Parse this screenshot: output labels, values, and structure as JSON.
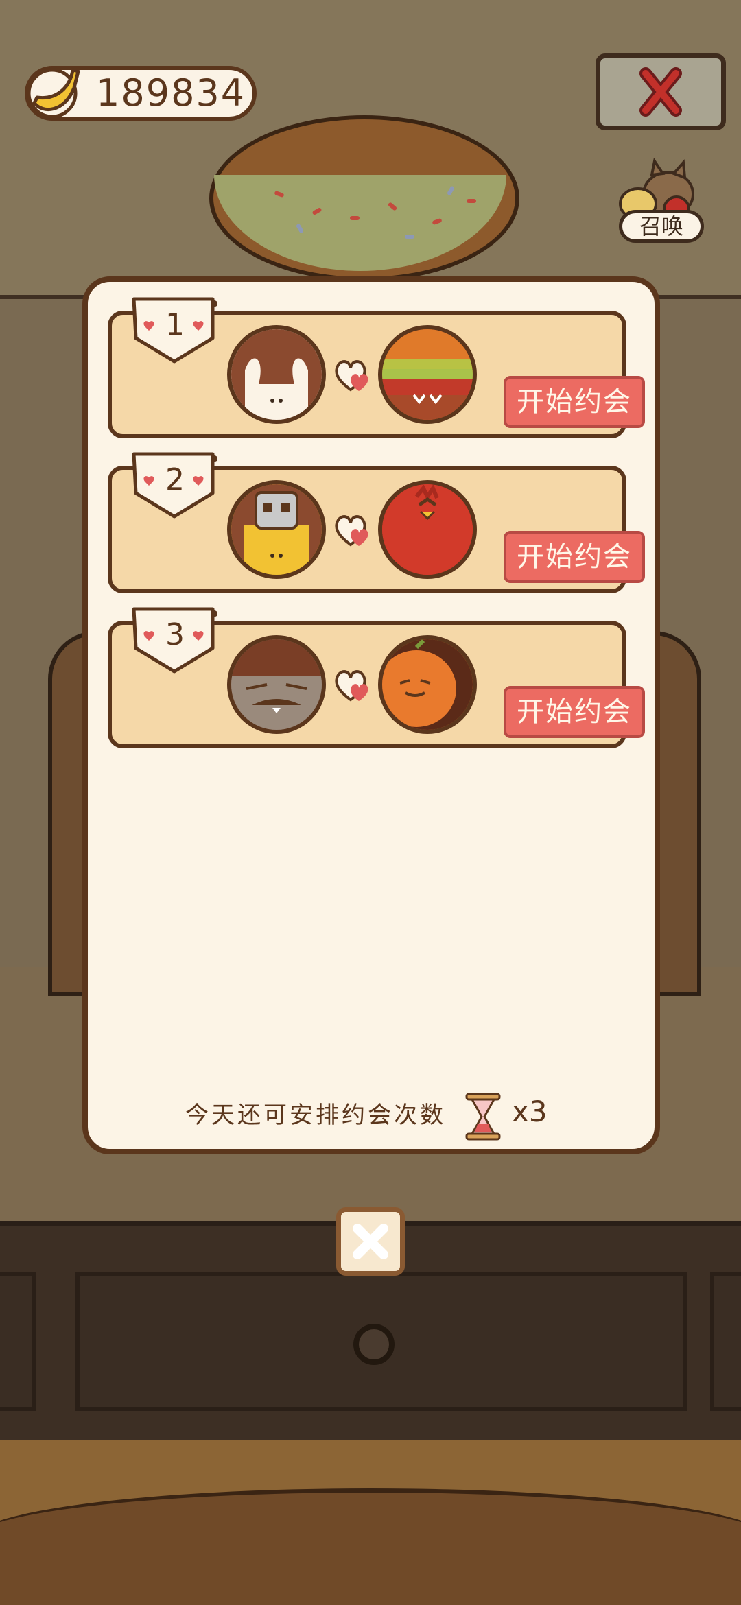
{
  "hud": {
    "coins": "189834",
    "close_icon": "close-icon",
    "summon_label": "召唤"
  },
  "dates": [
    {
      "rank": "1",
      "left": "white-bunny-cat",
      "right": "burger-creature",
      "button_label": "开始约会"
    },
    {
      "rank": "2",
      "left": "robot-yellow-cat",
      "right": "red-bird",
      "button_label": "开始约会"
    },
    {
      "rank": "3",
      "left": "gray-raccoon-cat",
      "right": "orange-pumpkin",
      "button_label": "开始约会"
    }
  ],
  "footer": {
    "label": "今天还可安排约会次数",
    "icon": "hourglass-icon",
    "remaining": "x3"
  },
  "colors": {
    "accent_button": "#ec6b62",
    "panel_bg": "#fcf4e6",
    "card_bg": "#f5d8a8",
    "outline": "#5b361c"
  }
}
